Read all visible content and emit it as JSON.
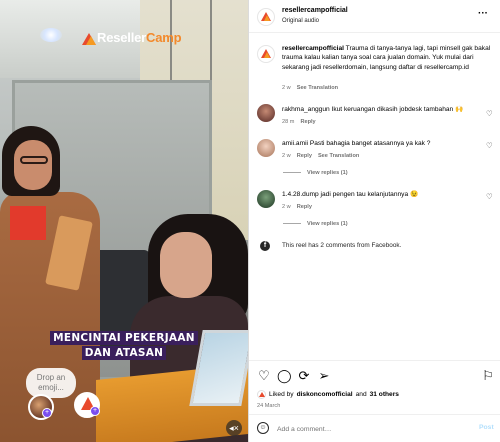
{
  "video": {
    "logo_part1": "Reseller",
    "logo_part2": "Camp",
    "caption_line1": "MENCINTAI PEKERJAAN",
    "caption_line2": "DAN ATASAN",
    "emoji_pill_placeholder": "Drop an emoji..."
  },
  "header": {
    "username": "resellercampofficial",
    "audio": "Original audio",
    "more": "···"
  },
  "caption_post": {
    "username": "resellercampofficial",
    "text": "Trauma di tanya-tanya lagi, tapi minsell gak bakal trauma kalau kalian tanya soal cara jualan domain. Yuk mulai dari sekarang jadi resellerdomain, langsung daftar di resellercamp.id",
    "time": "2 w",
    "translate": "See Translation"
  },
  "comments": [
    {
      "username": "rakhma_anggun",
      "text": "Ikut keruangan dikasih jobdesk tambahan 🙌",
      "time": "28 m",
      "actions": [
        "Reply"
      ]
    },
    {
      "username": "amii.amii",
      "text": "Pasti bahagia banget atasannya ya kak ?",
      "time": "2 w",
      "actions": [
        "Reply",
        "See Translation"
      ],
      "view_replies": "View replies (1)"
    },
    {
      "username": "1.4.28.dump",
      "text": "jadi pengen tau kelanjutannya 😉",
      "time": "2 w",
      "actions": [
        "Reply"
      ],
      "view_replies": "View replies (1)"
    }
  ],
  "facebook_note": "This reel has 2 comments from Facebook.",
  "likes": {
    "prefix": "Liked by",
    "user": "diskoncomofficial",
    "conjunction": "and",
    "others": "31 others"
  },
  "date": "24 March",
  "add_comment": {
    "placeholder": "Add a comment…",
    "post_label": "Post"
  },
  "icons": {
    "like": "heart-icon",
    "comment": "comment-icon",
    "repost": "repost-icon",
    "share": "share-icon",
    "save": "bookmark-icon",
    "emoji": "smiley-icon",
    "mute": "speaker-muted-icon",
    "facebook": "facebook-icon"
  },
  "colors": {
    "accent_orange": "#f3892b",
    "brand_red": "#e84a2d",
    "caption_bg": "#3a1f5c",
    "post_button": "#b2dffc",
    "meta_gray": "#737373"
  }
}
